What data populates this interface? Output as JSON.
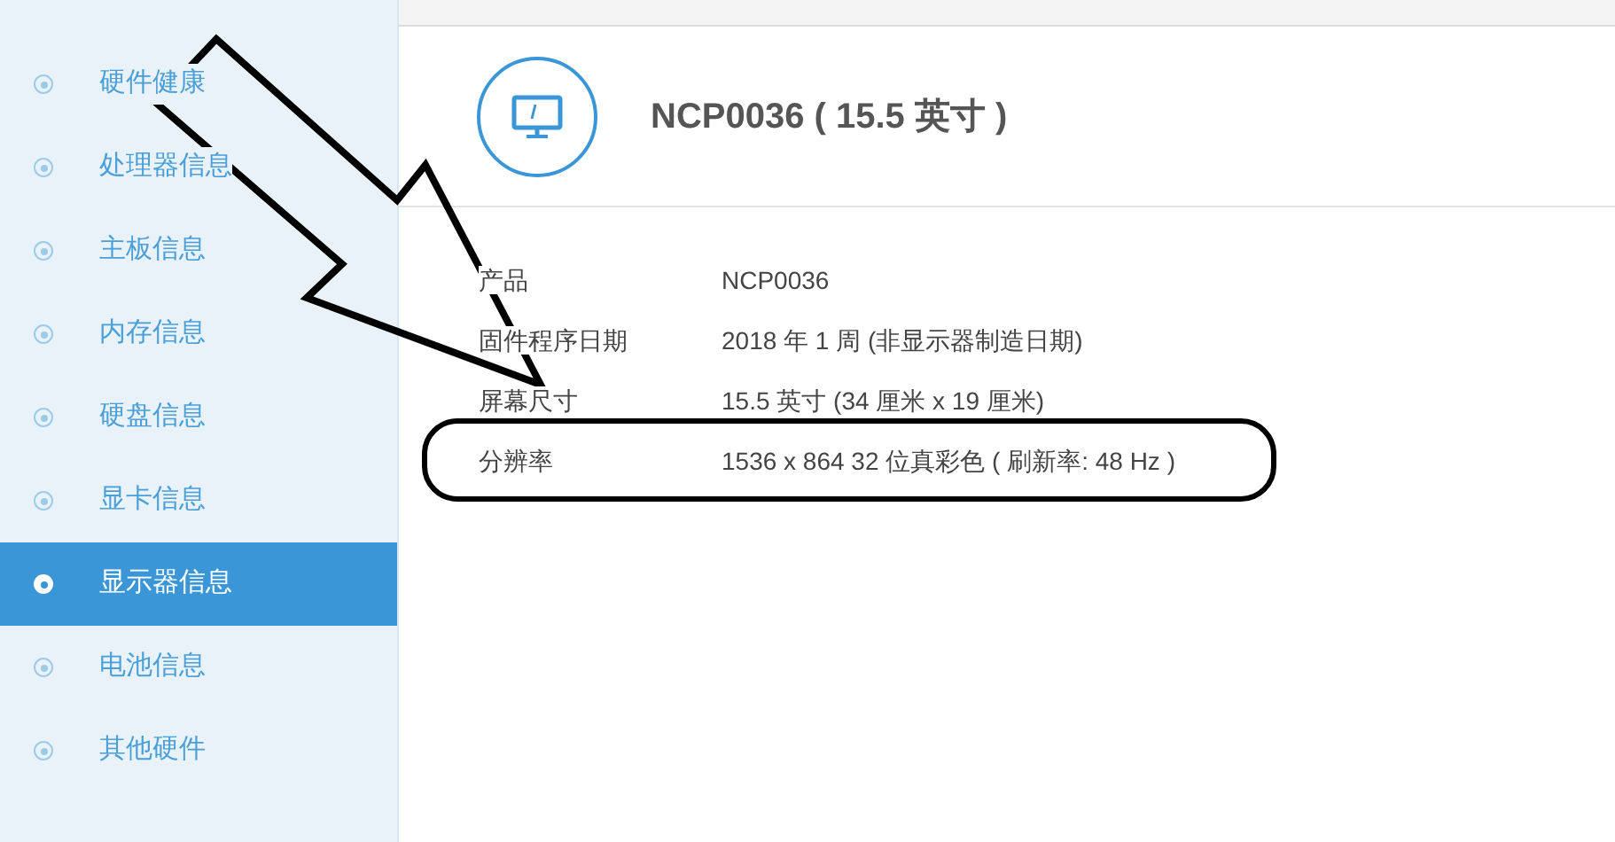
{
  "sidebar": {
    "items": [
      {
        "label": "硬件健康",
        "selected": false
      },
      {
        "label": "处理器信息",
        "selected": false
      },
      {
        "label": "主板信息",
        "selected": false
      },
      {
        "label": "内存信息",
        "selected": false
      },
      {
        "label": "硬盘信息",
        "selected": false
      },
      {
        "label": "显卡信息",
        "selected": false
      },
      {
        "label": "显示器信息",
        "selected": true
      },
      {
        "label": "电池信息",
        "selected": false
      },
      {
        "label": "其他硬件",
        "selected": false
      }
    ]
  },
  "device": {
    "title": "NCP0036 ( 15.5 英寸 )"
  },
  "details": [
    {
      "label": "产品",
      "value": "NCP0036",
      "highlighted": false
    },
    {
      "label": "固件程序日期",
      "value": "2018 年 1 周 (非显示器制造日期)",
      "highlighted": false
    },
    {
      "label": "屏幕尺寸",
      "value": "15.5 英寸 (34 厘米 x 19 厘米)",
      "highlighted": false
    },
    {
      "label": "分辨率",
      "value": "1536 x 864 32 位真彩色 ( 刷新率: 48 Hz )",
      "highlighted": true
    }
  ]
}
